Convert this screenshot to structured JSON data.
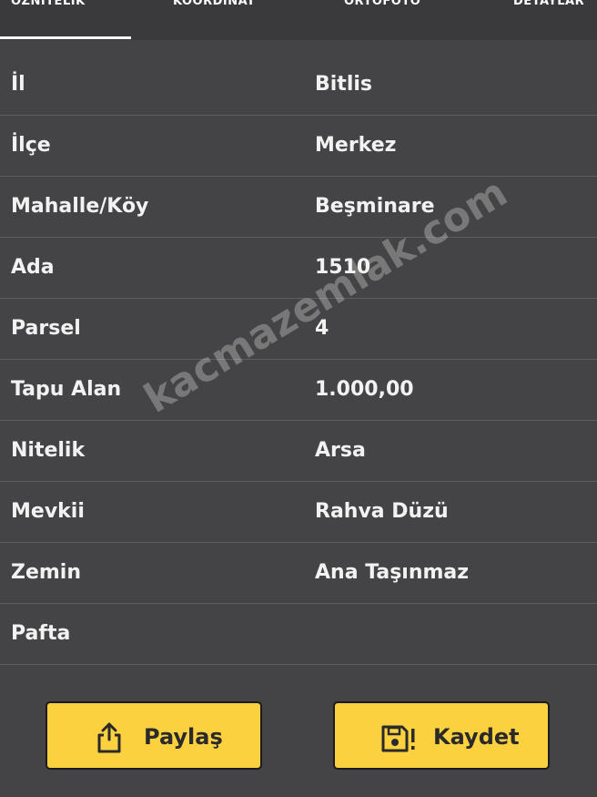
{
  "tabs": [
    {
      "label": "ÖZNİTELİK"
    },
    {
      "label": "KOORDİNAT"
    },
    {
      "label": "ORTOFOTO"
    },
    {
      "label": "DETAYLAR"
    }
  ],
  "rows": [
    {
      "label": "İl",
      "value": "Bitlis"
    },
    {
      "label": "İlçe",
      "value": "Merkez"
    },
    {
      "label": "Mahalle/Köy",
      "value": "Beşminare"
    },
    {
      "label": "Ada",
      "value": "1510"
    },
    {
      "label": "Parsel",
      "value": "4"
    },
    {
      "label": "Tapu Alan",
      "value": "1.000,00"
    },
    {
      "label": "Nitelik",
      "value": "Arsa"
    },
    {
      "label": "Mevkii",
      "value": "Rahva Düzü"
    },
    {
      "label": "Zemin",
      "value": "Ana Taşınmaz"
    },
    {
      "label": "Pafta",
      "value": ""
    }
  ],
  "watermark": "kacmazemlak.com",
  "buttons": {
    "share_label": "Paylaş",
    "save_label": "Kaydet"
  },
  "icons": {
    "share": "share-icon",
    "save": "save-icon"
  },
  "colors": {
    "background": "#444446",
    "button": "#fbd140",
    "text": "#f2f2f2"
  }
}
